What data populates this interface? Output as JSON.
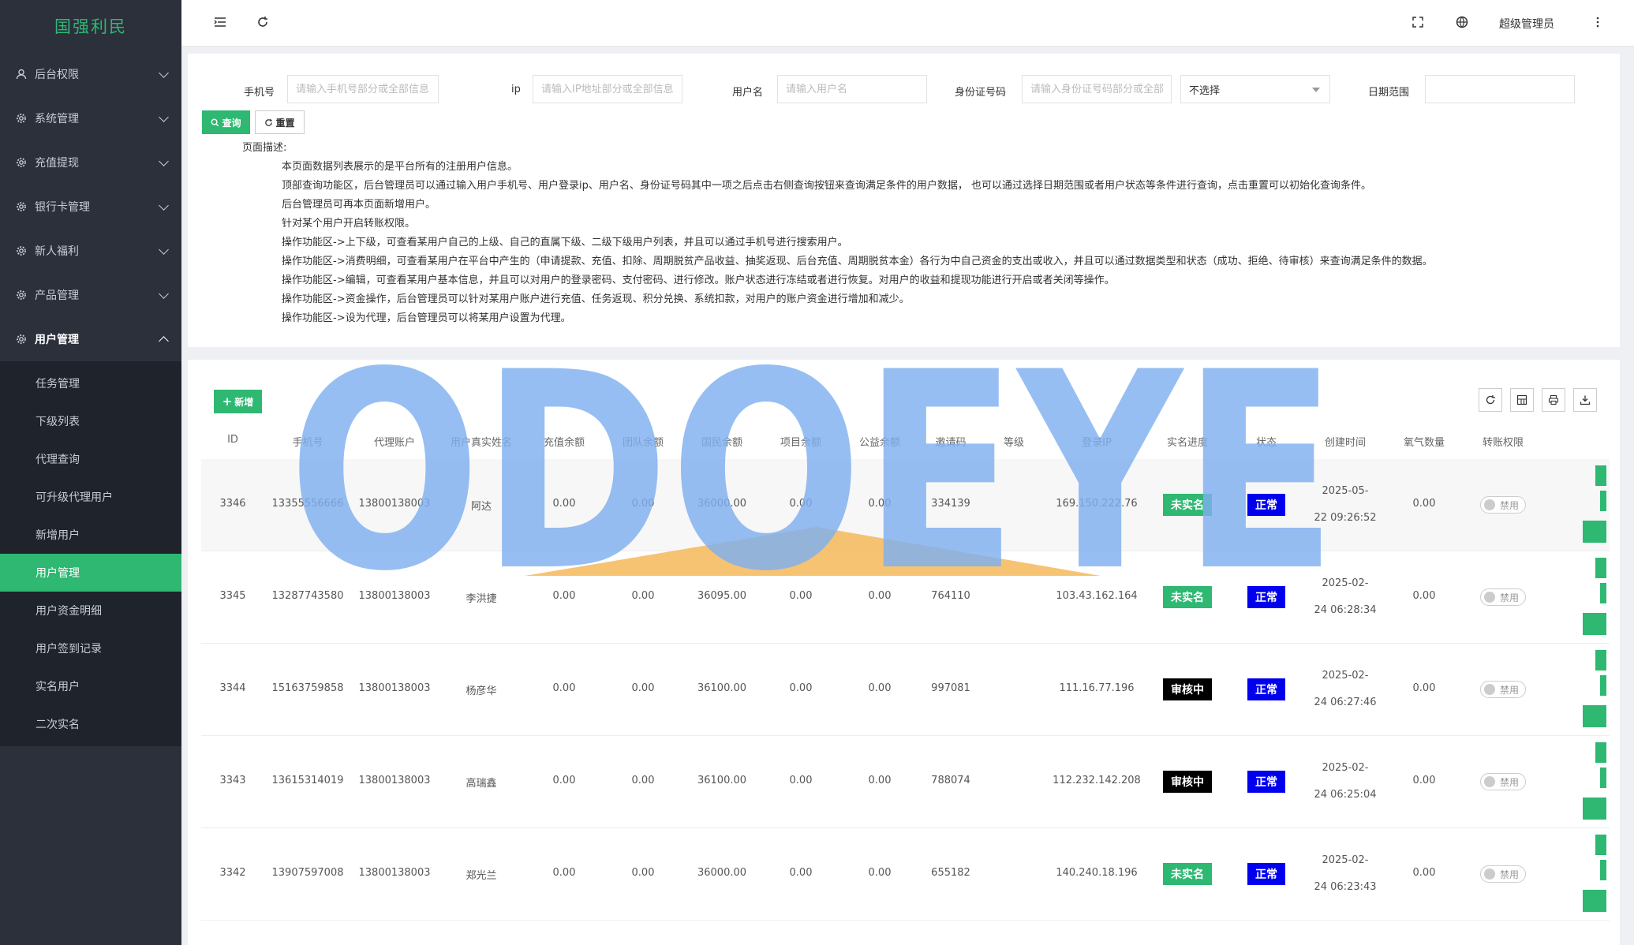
{
  "brand": "国强利民",
  "sidebar": {
    "menus": [
      {
        "label": "后台权限",
        "icon": "user-icon"
      },
      {
        "label": "系统管理",
        "icon": "gear-icon"
      },
      {
        "label": "充值提现",
        "icon": "gear-icon"
      },
      {
        "label": "银行卡管理",
        "icon": "gear-icon"
      },
      {
        "label": "新人福利",
        "icon": "gear-icon"
      },
      {
        "label": "产品管理",
        "icon": "gear-icon"
      },
      {
        "label": "用户管理",
        "icon": "gear-icon"
      }
    ],
    "submenu": [
      "任务管理",
      "下级列表",
      "代理查询",
      "可升级代理用户",
      "新增用户",
      "用户管理",
      "用户资金明细",
      "用户签到记录",
      "实名用户",
      "二次实名"
    ],
    "active_sub": "用户管理"
  },
  "topbar": {
    "admin": "超级管理员"
  },
  "filters": {
    "phone_label": "手机号",
    "phone_placeholder": "请输入手机号部分或全部信息",
    "ip_label": "ip",
    "ip_placeholder": "请输入IP地址部分或全部信息",
    "username_label": "用户名",
    "username_placeholder": "请输入用户名",
    "idcard_label": "身份证号码",
    "idcard_placeholder": "请输入身份证号码部分或全部信息",
    "status_select": "不选择",
    "date_label": "日期范围",
    "query_btn": "查询",
    "reset_btn": "重置"
  },
  "description": {
    "title": "页面描述:",
    "lines": [
      "本页面数据列表展示的是平台所有的注册用户信息。",
      "顶部查询功能区，后台管理员可以通过输入用户手机号、用户登录ip、用户名、身份证号码其中一项之后点击右侧查询按钮来查询满足条件的用户数据， 也可以通过选择日期范围或者用户状态等条件进行查询，点击重置可以初始化查询条件。",
      "后台管理员可再本页面新增用户。",
      "针对某个用户开启转账权限。",
      "操作功能区->上下级，可查看某用户自己的上级、自己的直属下级、二级下级用户列表，并且可以通过手机号进行搜索用户。",
      "操作功能区->消费明细，可查看某用户在平台中产生的（申请提款、充值、扣除、周期脱贫产品收益、抽奖返现、后台充值、周期脱贫本金）各行为中自己资金的支出或收入，并且可以通过数据类型和状态（成功、拒绝、待审核）来查询满足条件的数据。",
      "操作功能区->编辑，可查看某用户基本信息，并且可以对用户的登录密码、支付密码、进行修改。账户状态进行冻结或者进行恢复。对用户的收益和提现功能进行开启或者关闭等操作。",
      "操作功能区->资金操作，后台管理员可以针对某用户账户进行充值、任务返现、积分兑换、系统扣款，对用户的账户资金进行增加和减少。",
      "操作功能区->设为代理，后台管理员可以将某用户设置为代理。"
    ]
  },
  "table": {
    "add_btn": "新增",
    "headers": [
      "ID",
      "手机号",
      "代理账户",
      "用户真实姓名",
      "充值余额",
      "团队余额",
      "国民余额",
      "项目余额",
      "公益余额",
      "邀请码",
      "等级",
      "登录IP",
      "实名进度",
      "状态",
      "创建时间",
      "氧气数量",
      "转账权限"
    ],
    "rows": [
      {
        "id": "3346",
        "phone": "13355556666",
        "agent": "13800138003",
        "name": "阿达",
        "recharge": "0.00",
        "team": "0.00",
        "national": "36000.00",
        "project": "0.00",
        "charity": "0.00",
        "invite": "334139",
        "level": "",
        "ip": "169.150.222.76",
        "realname": "未实名",
        "realname_color": "#2eb872",
        "status": "正常",
        "time1": "2025-05-",
        "time2": "22 09:26:52",
        "oxygen": "0.00",
        "transfer": "禁用"
      },
      {
        "id": "3345",
        "phone": "13287743580",
        "agent": "13800138003",
        "name": "李洪捷",
        "recharge": "0.00",
        "team": "0.00",
        "national": "36095.00",
        "project": "0.00",
        "charity": "0.00",
        "invite": "764110",
        "level": "",
        "ip": "103.43.162.164",
        "realname": "未实名",
        "realname_color": "#2eb872",
        "status": "正常",
        "time1": "2025-02-",
        "time2": "24 06:28:34",
        "oxygen": "0.00",
        "transfer": "禁用"
      },
      {
        "id": "3344",
        "phone": "15163759858",
        "agent": "13800138003",
        "name": "杨彦华",
        "recharge": "0.00",
        "team": "0.00",
        "national": "36100.00",
        "project": "0.00",
        "charity": "0.00",
        "invite": "997081",
        "level": "",
        "ip": "111.16.77.196",
        "realname": "审核中",
        "realname_color": "#000000",
        "status": "正常",
        "time1": "2025-02-",
        "time2": "24 06:27:46",
        "oxygen": "0.00",
        "transfer": "禁用"
      },
      {
        "id": "3343",
        "phone": "13615314019",
        "agent": "13800138003",
        "name": "高瑞鑫",
        "recharge": "0.00",
        "team": "0.00",
        "national": "36100.00",
        "project": "0.00",
        "charity": "0.00",
        "invite": "788074",
        "level": "",
        "ip": "112.232.142.208",
        "realname": "审核中",
        "realname_color": "#000000",
        "status": "正常",
        "time1": "2025-02-",
        "time2": "24 06:25:04",
        "oxygen": "0.00",
        "transfer": "禁用"
      },
      {
        "id": "3342",
        "phone": "13907597008",
        "agent": "13800138003",
        "name": "郑光兰",
        "recharge": "0.00",
        "team": "0.00",
        "national": "36000.00",
        "project": "0.00",
        "charity": "0.00",
        "invite": "655182",
        "level": "",
        "ip": "140.240.18.196",
        "realname": "未实名",
        "realname_color": "#2eb872",
        "status": "正常",
        "time1": "2025-02-",
        "time2": "24 06:23:43",
        "oxygen": "0.00",
        "transfer": "禁用"
      }
    ]
  },
  "watermark": {
    "text": "ODOEYE",
    "color": "#7fb0f0",
    "accent": "#f5b85a"
  },
  "colors": {
    "accent": "#2eb872",
    "sidebar": "#2b303b",
    "status_blue": "#0000ee"
  }
}
